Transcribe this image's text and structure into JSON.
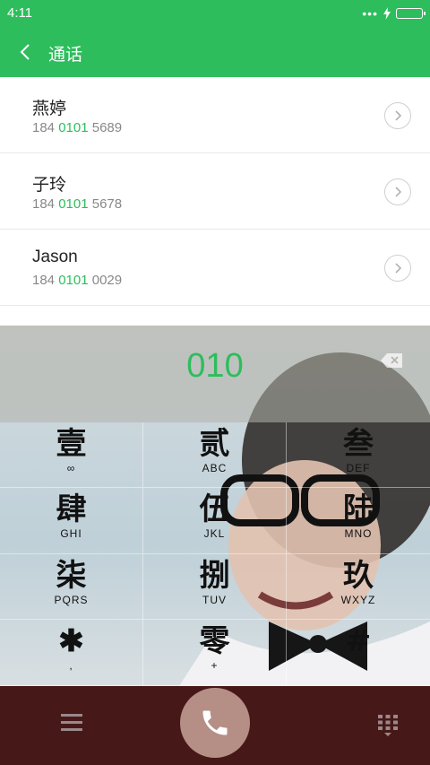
{
  "status_bar": {
    "time": "4:11",
    "dots": "•••",
    "icons": [
      "charging-bolt-icon",
      "battery-icon"
    ]
  },
  "app_bar": {
    "title": "通话",
    "back_icon": "chevron-left-icon"
  },
  "contacts": [
    {
      "name": "燕婷",
      "number_prefix": "184 ",
      "number_match": "0101",
      "number_suffix": " 5689"
    },
    {
      "name": "子玲",
      "number_prefix": "184 ",
      "number_match": "0101",
      "number_suffix": " 5678"
    },
    {
      "name": "Jason",
      "number_prefix": "184 ",
      "number_match": "0101",
      "number_suffix": " 0029"
    }
  ],
  "dialer": {
    "typed_number": "010",
    "backspace_icon": "backspace-icon",
    "keys": [
      {
        "char": "壹",
        "letters": "∞"
      },
      {
        "char": "贰",
        "letters": "ABC"
      },
      {
        "char": "叁",
        "letters": "DEF"
      },
      {
        "char": "肆",
        "letters": "GHI"
      },
      {
        "char": "伍",
        "letters": "JKL"
      },
      {
        "char": "陆",
        "letters": "MNO"
      },
      {
        "char": "柒",
        "letters": "PQRS"
      },
      {
        "char": "捌",
        "letters": "TUV"
      },
      {
        "char": "玖",
        "letters": "WXYZ"
      },
      {
        "char": "✱",
        "letters": ","
      },
      {
        "char": "零",
        "letters": "+"
      },
      {
        "char": "#",
        "letters": ""
      }
    ]
  },
  "bottom_bar": {
    "menu_icon": "menu-icon",
    "call_icon": "phone-icon",
    "dialpad_icon": "dialpad-icon"
  },
  "colors": {
    "accent": "#2dbd5c",
    "bottom_bar": "#471818",
    "call_button": "#b58f86"
  }
}
